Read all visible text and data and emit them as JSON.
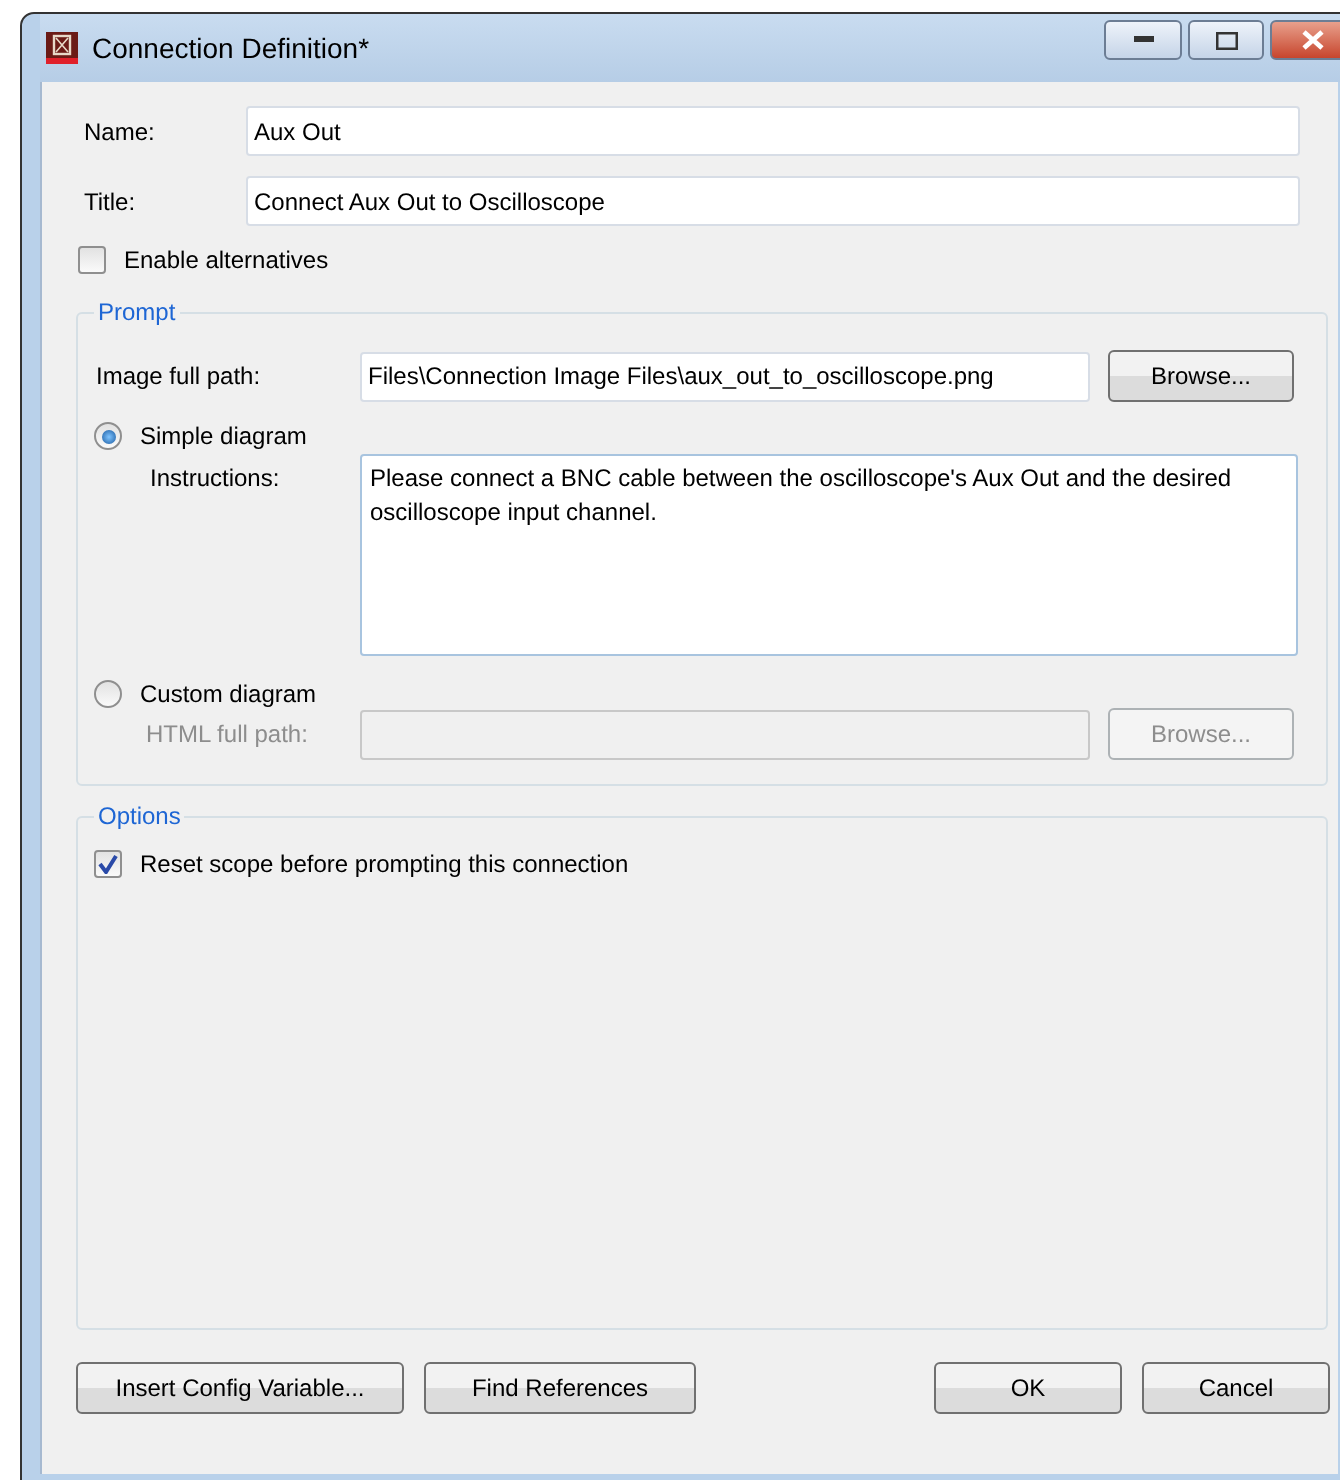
{
  "window": {
    "title": "Connection Definition*"
  },
  "fields": [
    {
      "label": "Name:",
      "value": "Aux Out"
    },
    {
      "label": "Title:",
      "value": "Connect Aux Out to Oscilloscope"
    }
  ],
  "enable_alternatives": {
    "label": "Enable alternatives",
    "checked": false
  },
  "prompt": {
    "title": "Prompt",
    "image_path": {
      "label": "Image full path:",
      "value": "Files\\Connection Image Files\\aux_out_to_oscilloscope.png",
      "button": "Browse..."
    },
    "modes": [
      {
        "label": "Simple diagram",
        "selected": true
      },
      {
        "label": "Custom diagram",
        "selected": false
      }
    ],
    "instructions": {
      "label": "Instructions:",
      "value": "Please connect a BNC cable between the oscilloscope's Aux Out and the desired oscilloscope input channel."
    },
    "html_path": {
      "label": "HTML full path:",
      "button": "Browse...",
      "disabled": true
    }
  },
  "options": {
    "title": "Options",
    "items": [
      {
        "label": "Reset scope before prompting this connection",
        "checked": true
      }
    ]
  },
  "buttons_left": [
    "Insert Config Variable...",
    "Find References"
  ],
  "buttons_right": [
    "OK",
    "Cancel"
  ]
}
